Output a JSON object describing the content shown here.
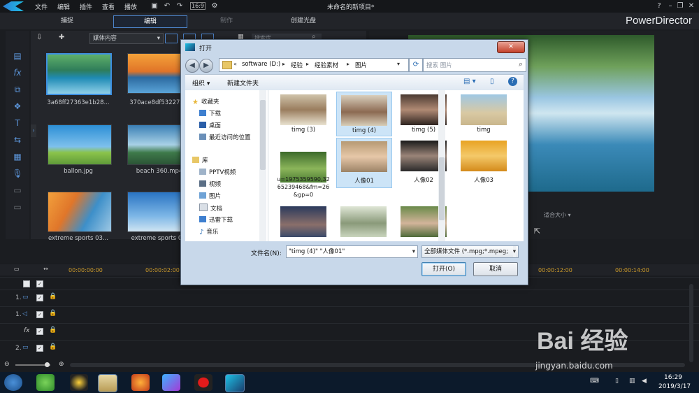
{
  "app": {
    "menus": [
      "文件",
      "编辑",
      "插件",
      "查看",
      "播放"
    ],
    "zoom": "16:9",
    "window_title": "未命名的新项目*",
    "brand": "PowerDirector",
    "modes": [
      "捕捉",
      "编辑",
      "制作",
      "创建光盘"
    ]
  },
  "library": {
    "dropdown": "媒体内容",
    "search_placeholder": "搜索库",
    "items": [
      {
        "name": "3a68ff27363e1b28..."
      },
      {
        "name": "370ace8df53227a..."
      },
      {
        "name": "ballon.jpg"
      },
      {
        "name": "beach 360.mp4"
      },
      {
        "name": "extreme sports 03..."
      },
      {
        "name": "extreme sports 0..."
      }
    ]
  },
  "preview": {
    "fit_label": "适合大小"
  },
  "timeline": {
    "ruler": [
      "00:00:00:00",
      "00:00:02:00",
      "00:00:12:00",
      "00:00:14:00"
    ],
    "tracks": [
      "1.",
      "1.",
      "2."
    ]
  },
  "dialog": {
    "title": "打开",
    "breadcrumb": [
      "software (D:)",
      "经验",
      "经验素材",
      "图片"
    ],
    "search_placeholder": "搜索 图片",
    "organize": "组织",
    "new_folder": "新建文件夹",
    "nav": {
      "favorites": "收藏夹",
      "favorites_items": [
        "下载",
        "桌面",
        "最近访问的位置"
      ],
      "library": "库",
      "library_items": [
        "PPTV视频",
        "视频",
        "图片",
        "文档",
        "迅雷下载",
        "音乐"
      ]
    },
    "files": [
      {
        "name": "timg (3)",
        "selected": false
      },
      {
        "name": "timg (4)",
        "selected": true
      },
      {
        "name": "timg (5)",
        "selected": false
      },
      {
        "name": "timg",
        "selected": false
      },
      {
        "name": "u=1975359590,3265239468&fm=26&gp=0",
        "selected": false
      },
      {
        "name": "人像01",
        "selected": true
      },
      {
        "name": "人像02",
        "selected": false
      },
      {
        "name": "人像03",
        "selected": false
      },
      {
        "name": "",
        "selected": false
      },
      {
        "name": "",
        "selected": false
      },
      {
        "name": "",
        "selected": false
      }
    ],
    "filename_label": "文件名(N):",
    "filename_value": "\"timg (4)\" \"人像01\"",
    "filetype": "全部媒体文件 (*.mpg;*.mpeg;",
    "open_button": "打开(O)",
    "cancel_button": "取消"
  },
  "taskbar": {
    "time": "16:29",
    "date": "2019/3/17"
  },
  "watermark": {
    "text": "Bai 经验",
    "url": "jingyan.baidu.com"
  }
}
